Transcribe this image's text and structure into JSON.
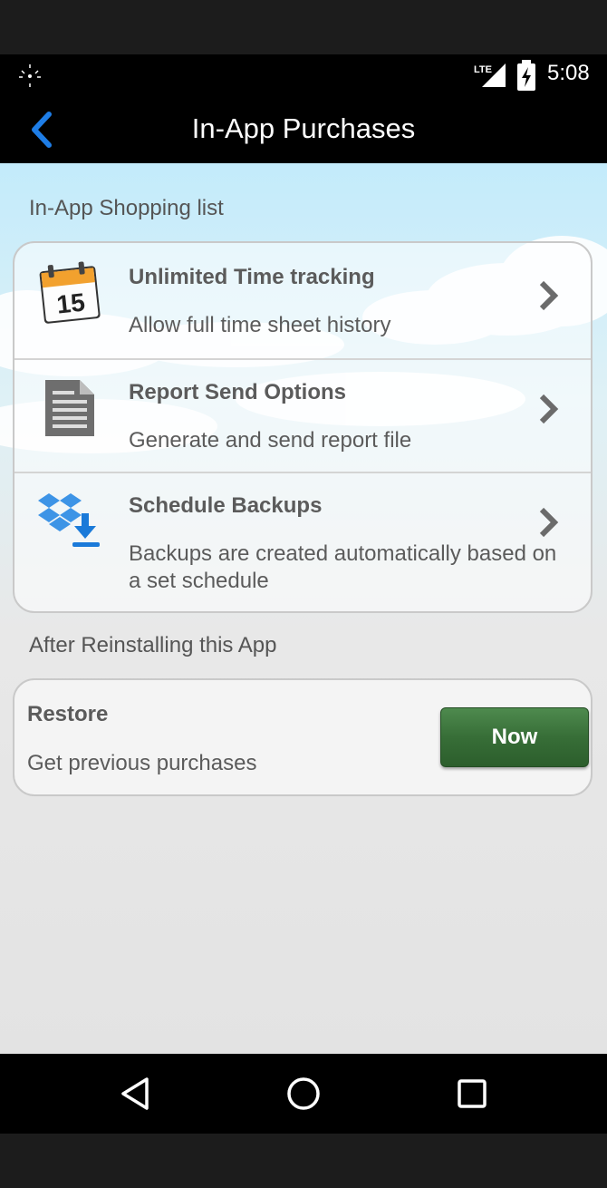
{
  "status_bar": {
    "network_label": "LTE",
    "time": "5:08",
    "icons": [
      "alarm-icon",
      "lte-signal-icon",
      "battery-charging-icon"
    ]
  },
  "action_bar": {
    "title": "In-App Purchases",
    "back_icon": "chevron-left-icon",
    "accent_color": "#1e7de6"
  },
  "shopping": {
    "section_label": "In-App Shopping list",
    "items": [
      {
        "title": "Unlimited Time tracking",
        "subtitle": "Allow full time sheet history",
        "icon": "calendar-icon",
        "calendar_day": "15"
      },
      {
        "title": "Report Send Options",
        "subtitle": "Generate and send report file",
        "icon": "document-icon"
      },
      {
        "title": "Schedule Backups",
        "subtitle": "Backups are created automatically based on a set schedule",
        "icon": "dropbox-download-icon"
      }
    ]
  },
  "restore": {
    "section_label": "After Reinstalling this App",
    "title": "Restore",
    "subtitle": "Get previous purchases",
    "button_label": "Now",
    "button_color": "#376e37"
  },
  "nav_bar": {
    "icons": [
      "back-triangle-icon",
      "home-circle-icon",
      "recents-square-icon"
    ]
  }
}
